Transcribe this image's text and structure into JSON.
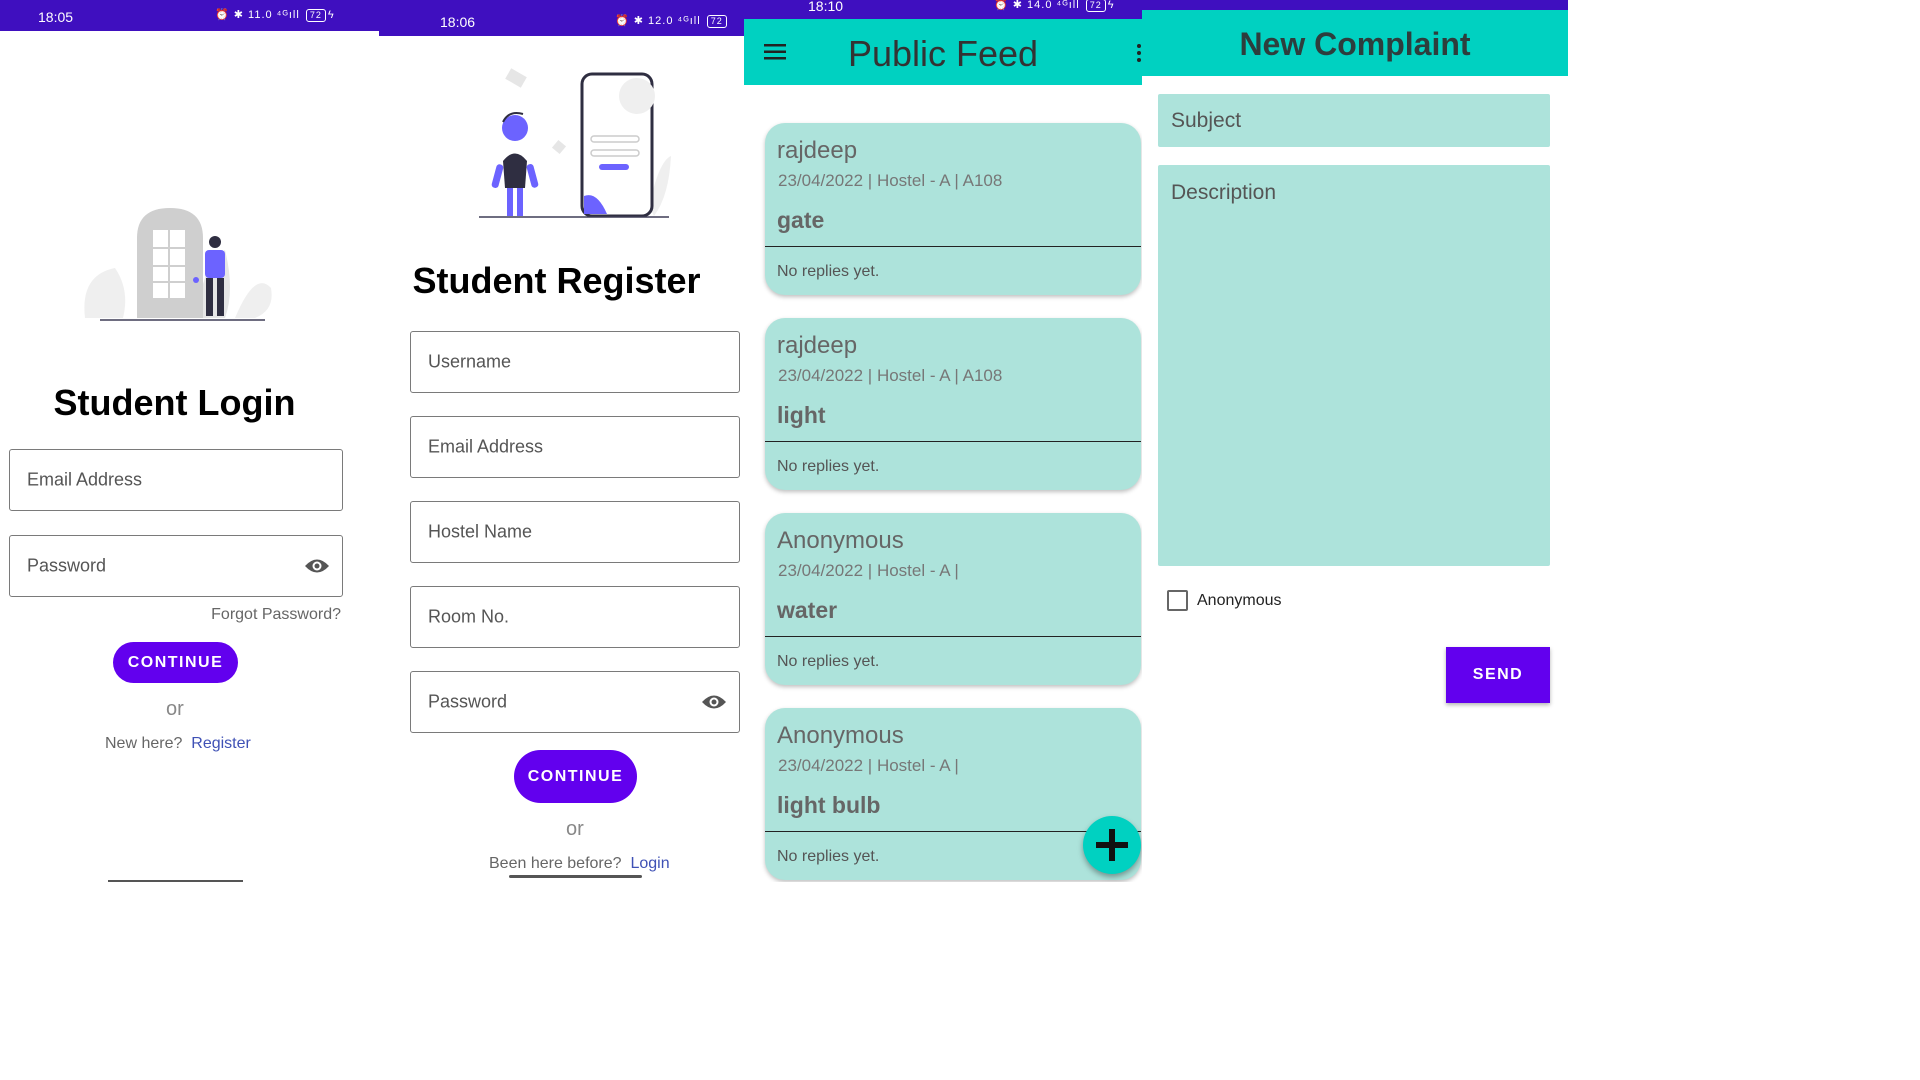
{
  "login": {
    "status": {
      "time": "18:05",
      "net": "11.0",
      "battery": "72"
    },
    "title": "Student Login",
    "email_placeholder": "Email Address",
    "password_placeholder": "Password",
    "forgot": "Forgot Password?",
    "continue": "CONTINUE",
    "or": "or",
    "new_here": "New here?",
    "register": "Register"
  },
  "register": {
    "status": {
      "time": "18:06",
      "net": "12.0",
      "battery": "72"
    },
    "title": "Student Register",
    "username": "Username",
    "email": "Email Address",
    "hostel": "Hostel Name",
    "room": "Room No.",
    "password": "Password",
    "continue": "CONTINUE",
    "or": "or",
    "been_here": "Been here before?",
    "login": "Login"
  },
  "feed": {
    "status": {
      "time": "18:10",
      "net": "14.0",
      "battery": "72"
    },
    "title": "Public Feed",
    "posts": [
      {
        "user": "rajdeep",
        "meta": "23/04/2022 | Hostel - A | A108",
        "subject": "gate",
        "reply": "No replies yet."
      },
      {
        "user": "rajdeep",
        "meta": "23/04/2022 | Hostel - A | A108",
        "subject": "light",
        "reply": "No replies yet."
      },
      {
        "user": "Anonymous",
        "meta": "23/04/2022 | Hostel - A |",
        "subject": "water",
        "reply": "No replies yet."
      },
      {
        "user": "Anonymous",
        "meta": "23/04/2022 | Hostel - A |",
        "subject": "light bulb",
        "reply": "No replies yet."
      }
    ]
  },
  "complaint": {
    "title": "New Complaint",
    "subject": "Subject",
    "description": "Description",
    "anonymous": "Anonymous",
    "send": "SEND"
  },
  "colors": {
    "status_bar": "#3f0fbf",
    "primary": "#6200ee",
    "appbar": "#00d1c1",
    "card": "#ade3db",
    "illustration_accent": "#6c63ff"
  }
}
